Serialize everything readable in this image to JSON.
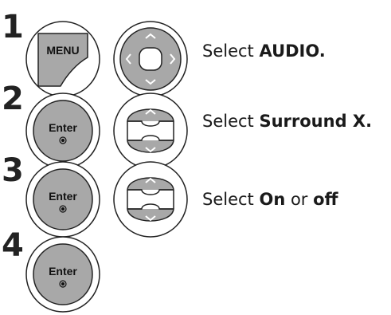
{
  "steps": [
    {
      "number": "1",
      "button_label": "MENU",
      "nav_icon": "four-way-arrows",
      "instruction": {
        "prefix": "Select ",
        "bold": "AUDIO.",
        "middle": "",
        "bold2": ""
      }
    },
    {
      "number": "2",
      "button_label": "Enter",
      "nav_icon": "up-down-arrows",
      "instruction": {
        "prefix": "Select ",
        "bold": "Surround X.",
        "middle": "",
        "bold2": ""
      }
    },
    {
      "number": "3",
      "button_label": "Enter",
      "nav_icon": "up-down-arrows",
      "instruction": {
        "prefix": "Select ",
        "bold": "On",
        "middle": " or ",
        "bold2": "off"
      }
    },
    {
      "number": "4",
      "button_label": "Enter",
      "nav_icon": "",
      "instruction": {
        "prefix": "",
        "bold": "",
        "middle": "",
        "bold2": ""
      }
    }
  ],
  "colors": {
    "button_fill": "#a8a8a8",
    "button_stroke": "#222222",
    "background": "#ffffff"
  }
}
